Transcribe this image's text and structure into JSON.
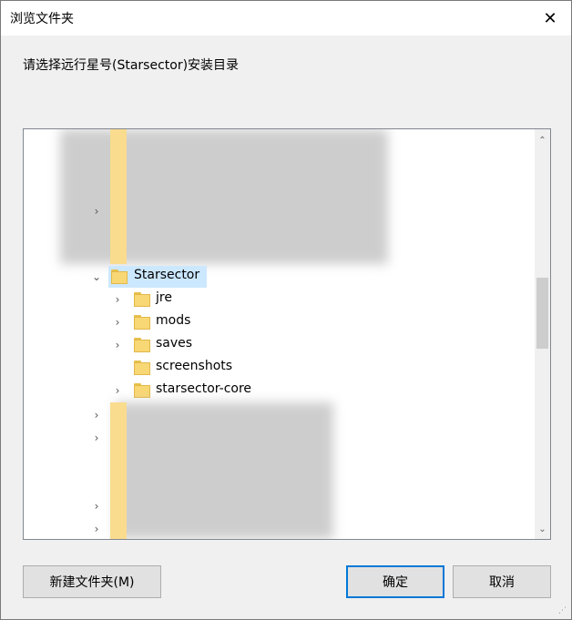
{
  "window": {
    "title": "浏览文件夹"
  },
  "prompt": "请选择远行星号(Starsector)安装目录",
  "tree": {
    "selected": "Starsector",
    "children": [
      {
        "label": "jre",
        "expandable": true
      },
      {
        "label": "mods",
        "expandable": true
      },
      {
        "label": "saves",
        "expandable": true
      },
      {
        "label": "screenshots",
        "expandable": false
      },
      {
        "label": "starsector-core",
        "expandable": true
      }
    ]
  },
  "buttons": {
    "new_folder": "新建文件夹(M)",
    "ok": "确定",
    "cancel": "取消"
  },
  "icons": {
    "expanded": "chevron-down-icon",
    "collapsed": "chevron-right-icon",
    "folder": "folder-icon"
  }
}
